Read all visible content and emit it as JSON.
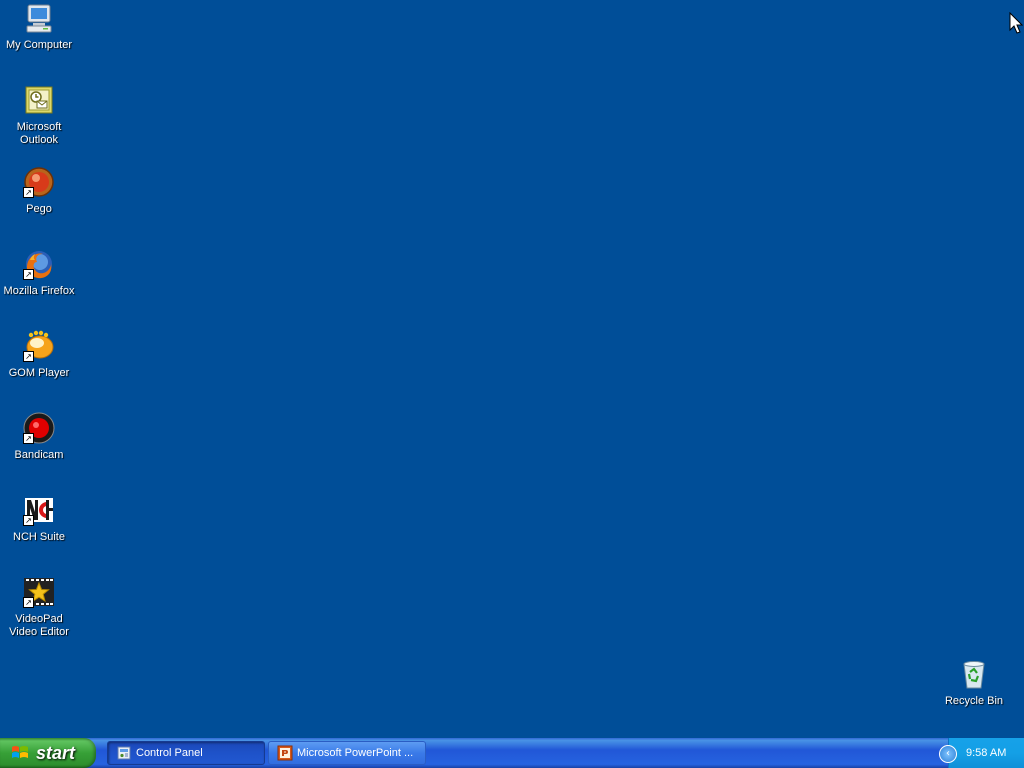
{
  "desktop": {
    "background": "#004e98",
    "icons": [
      {
        "label": "My Computer",
        "icon": "my-computer-icon"
      },
      {
        "label": "Microsoft Outlook",
        "icon": "outlook-icon"
      },
      {
        "label": "Pego",
        "icon": "pego-icon"
      },
      {
        "label": "Mozilla Firefox",
        "icon": "firefox-icon"
      },
      {
        "label": "GOM Player",
        "icon": "gom-player-icon"
      },
      {
        "label": "Bandicam",
        "icon": "bandicam-icon"
      },
      {
        "label": "NCH Suite",
        "icon": "nch-suite-icon"
      },
      {
        "label": "VideoPad Video Editor",
        "icon": "videopad-icon"
      },
      {
        "label": "Recycle Bin",
        "icon": "recycle-bin-icon"
      }
    ]
  },
  "taskbar": {
    "start_label": "start",
    "tasks": [
      {
        "label": "Control Panel",
        "icon": "control-panel-icon",
        "active": true
      },
      {
        "label": "Microsoft PowerPoint ...",
        "icon": "powerpoint-icon",
        "active": false
      }
    ],
    "tray": {
      "expand_glyph": "‹",
      "clock": "9:58 AM"
    }
  }
}
